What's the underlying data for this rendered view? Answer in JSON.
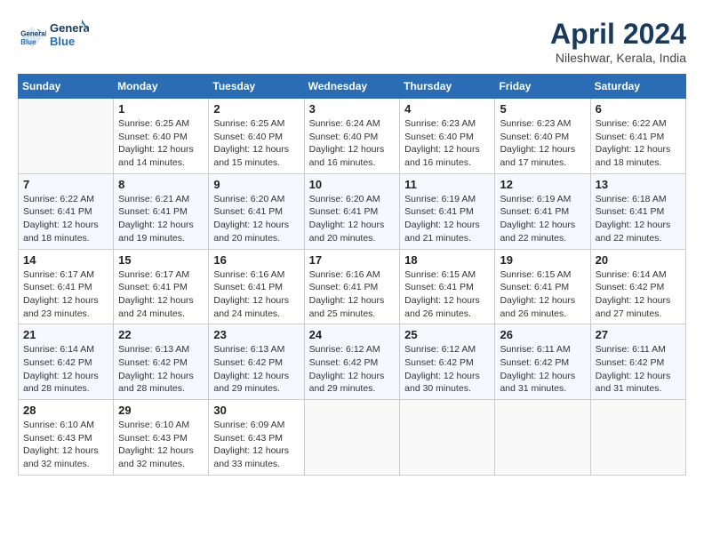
{
  "header": {
    "logo_line1": "General",
    "logo_line2": "Blue",
    "month_title": "April 2024",
    "subtitle": "Nileshwar, Kerala, India"
  },
  "weekdays": [
    "Sunday",
    "Monday",
    "Tuesday",
    "Wednesday",
    "Thursday",
    "Friday",
    "Saturday"
  ],
  "weeks": [
    [
      {
        "day": "",
        "info": ""
      },
      {
        "day": "1",
        "info": "Sunrise: 6:25 AM\nSunset: 6:40 PM\nDaylight: 12 hours\nand 14 minutes."
      },
      {
        "day": "2",
        "info": "Sunrise: 6:25 AM\nSunset: 6:40 PM\nDaylight: 12 hours\nand 15 minutes."
      },
      {
        "day": "3",
        "info": "Sunrise: 6:24 AM\nSunset: 6:40 PM\nDaylight: 12 hours\nand 16 minutes."
      },
      {
        "day": "4",
        "info": "Sunrise: 6:23 AM\nSunset: 6:40 PM\nDaylight: 12 hours\nand 16 minutes."
      },
      {
        "day": "5",
        "info": "Sunrise: 6:23 AM\nSunset: 6:40 PM\nDaylight: 12 hours\nand 17 minutes."
      },
      {
        "day": "6",
        "info": "Sunrise: 6:22 AM\nSunset: 6:41 PM\nDaylight: 12 hours\nand 18 minutes."
      }
    ],
    [
      {
        "day": "7",
        "info": "Sunrise: 6:22 AM\nSunset: 6:41 PM\nDaylight: 12 hours\nand 18 minutes."
      },
      {
        "day": "8",
        "info": "Sunrise: 6:21 AM\nSunset: 6:41 PM\nDaylight: 12 hours\nand 19 minutes."
      },
      {
        "day": "9",
        "info": "Sunrise: 6:20 AM\nSunset: 6:41 PM\nDaylight: 12 hours\nand 20 minutes."
      },
      {
        "day": "10",
        "info": "Sunrise: 6:20 AM\nSunset: 6:41 PM\nDaylight: 12 hours\nand 20 minutes."
      },
      {
        "day": "11",
        "info": "Sunrise: 6:19 AM\nSunset: 6:41 PM\nDaylight: 12 hours\nand 21 minutes."
      },
      {
        "day": "12",
        "info": "Sunrise: 6:19 AM\nSunset: 6:41 PM\nDaylight: 12 hours\nand 22 minutes."
      },
      {
        "day": "13",
        "info": "Sunrise: 6:18 AM\nSunset: 6:41 PM\nDaylight: 12 hours\nand 22 minutes."
      }
    ],
    [
      {
        "day": "14",
        "info": "Sunrise: 6:17 AM\nSunset: 6:41 PM\nDaylight: 12 hours\nand 23 minutes."
      },
      {
        "day": "15",
        "info": "Sunrise: 6:17 AM\nSunset: 6:41 PM\nDaylight: 12 hours\nand 24 minutes."
      },
      {
        "day": "16",
        "info": "Sunrise: 6:16 AM\nSunset: 6:41 PM\nDaylight: 12 hours\nand 24 minutes."
      },
      {
        "day": "17",
        "info": "Sunrise: 6:16 AM\nSunset: 6:41 PM\nDaylight: 12 hours\nand 25 minutes."
      },
      {
        "day": "18",
        "info": "Sunrise: 6:15 AM\nSunset: 6:41 PM\nDaylight: 12 hours\nand 26 minutes."
      },
      {
        "day": "19",
        "info": "Sunrise: 6:15 AM\nSunset: 6:41 PM\nDaylight: 12 hours\nand 26 minutes."
      },
      {
        "day": "20",
        "info": "Sunrise: 6:14 AM\nSunset: 6:42 PM\nDaylight: 12 hours\nand 27 minutes."
      }
    ],
    [
      {
        "day": "21",
        "info": "Sunrise: 6:14 AM\nSunset: 6:42 PM\nDaylight: 12 hours\nand 28 minutes."
      },
      {
        "day": "22",
        "info": "Sunrise: 6:13 AM\nSunset: 6:42 PM\nDaylight: 12 hours\nand 28 minutes."
      },
      {
        "day": "23",
        "info": "Sunrise: 6:13 AM\nSunset: 6:42 PM\nDaylight: 12 hours\nand 29 minutes."
      },
      {
        "day": "24",
        "info": "Sunrise: 6:12 AM\nSunset: 6:42 PM\nDaylight: 12 hours\nand 29 minutes."
      },
      {
        "day": "25",
        "info": "Sunrise: 6:12 AM\nSunset: 6:42 PM\nDaylight: 12 hours\nand 30 minutes."
      },
      {
        "day": "26",
        "info": "Sunrise: 6:11 AM\nSunset: 6:42 PM\nDaylight: 12 hours\nand 31 minutes."
      },
      {
        "day": "27",
        "info": "Sunrise: 6:11 AM\nSunset: 6:42 PM\nDaylight: 12 hours\nand 31 minutes."
      }
    ],
    [
      {
        "day": "28",
        "info": "Sunrise: 6:10 AM\nSunset: 6:43 PM\nDaylight: 12 hours\nand 32 minutes."
      },
      {
        "day": "29",
        "info": "Sunrise: 6:10 AM\nSunset: 6:43 PM\nDaylight: 12 hours\nand 32 minutes."
      },
      {
        "day": "30",
        "info": "Sunrise: 6:09 AM\nSunset: 6:43 PM\nDaylight: 12 hours\nand 33 minutes."
      },
      {
        "day": "",
        "info": ""
      },
      {
        "day": "",
        "info": ""
      },
      {
        "day": "",
        "info": ""
      },
      {
        "day": "",
        "info": ""
      }
    ]
  ]
}
